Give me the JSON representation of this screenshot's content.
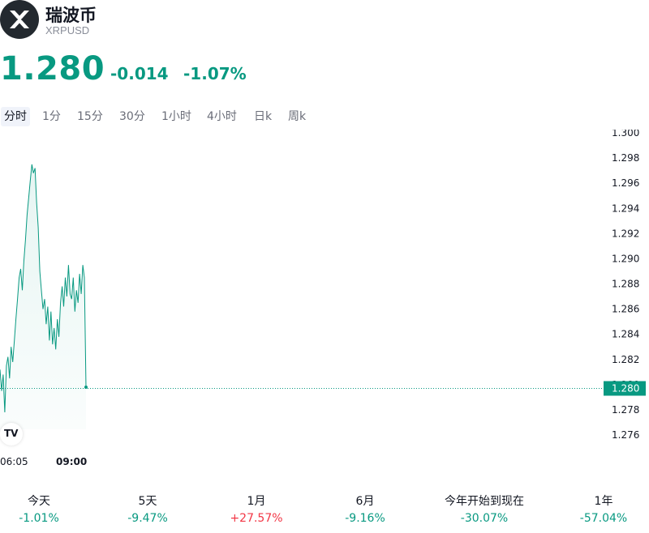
{
  "header": {
    "title": "瑞波币",
    "ticker": "XRPUSD",
    "logo_icon": "xrp-x-icon"
  },
  "quote": {
    "price": "1.280",
    "change": "-0.014",
    "change_pct": "-1.07%",
    "color": "#089981"
  },
  "tabs": [
    {
      "label": "分时",
      "active": true
    },
    {
      "label": "1分",
      "active": false
    },
    {
      "label": "15分",
      "active": false
    },
    {
      "label": "30分",
      "active": false
    },
    {
      "label": "1小时",
      "active": false
    },
    {
      "label": "4小时",
      "active": false
    },
    {
      "label": "日k",
      "active": false
    },
    {
      "label": "周k",
      "active": false
    }
  ],
  "chart_data": {
    "type": "area",
    "line_color": "#089981",
    "y_ticks": [
      "1.300",
      "1.298",
      "1.296",
      "1.294",
      "1.292",
      "1.290",
      "1.288",
      "1.286",
      "1.284",
      "1.282",
      "1.280",
      "1.278",
      "1.276"
    ],
    "ylim": [
      1.275,
      1.3
    ],
    "x_labels": [
      "06:05",
      "09:00"
    ],
    "last_price_label": "1.280",
    "last_price": 1.2797,
    "series": [
      {
        "values": [
          1.2812,
          1.2795,
          1.2808,
          1.2778,
          1.2815,
          1.2822,
          1.2805,
          1.283,
          1.2818,
          1.2835,
          1.2852,
          1.2868,
          1.2885,
          1.2892,
          1.2875,
          1.2898,
          1.2915,
          1.2935,
          1.2948,
          1.2962,
          1.2975,
          1.2968,
          1.2972,
          1.2945,
          1.2925,
          1.289,
          1.2875,
          1.286,
          1.2868,
          1.2848,
          1.2862,
          1.2835,
          1.2858,
          1.2832,
          1.2845,
          1.2828,
          1.2852,
          1.2838,
          1.2865,
          1.2878,
          1.2862,
          1.2885,
          1.287,
          1.2895,
          1.2872,
          1.2868,
          1.2885,
          1.2858,
          1.2875,
          1.2865,
          1.2888,
          1.2872,
          1.2895,
          1.2885,
          1.2798
        ]
      }
    ]
  },
  "periods": [
    {
      "label": "今天",
      "value": "-1.01%",
      "dir": "neg"
    },
    {
      "label": "5天",
      "value": "-9.47%",
      "dir": "neg"
    },
    {
      "label": "1月",
      "value": "+27.57%",
      "dir": "pos"
    },
    {
      "label": "6月",
      "value": "-9.16%",
      "dir": "neg"
    },
    {
      "label": "今年开始到现在",
      "value": "-30.07%",
      "dir": "neg"
    },
    {
      "label": "1年",
      "value": "-57.04%",
      "dir": "neg"
    }
  ]
}
